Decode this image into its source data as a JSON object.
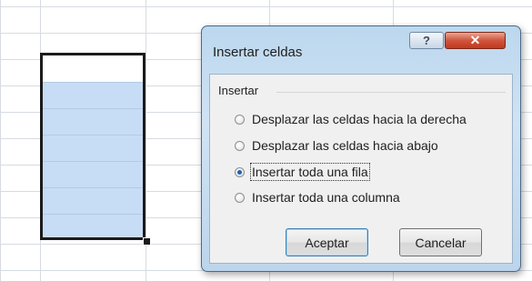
{
  "dialog": {
    "title": "Insertar celdas",
    "help_label": "?",
    "close_label": "✕",
    "group_label": "Insertar",
    "options": [
      {
        "label": "Desplazar las celdas hacia la derecha",
        "selected": false
      },
      {
        "label": "Desplazar las celdas hacia abajo",
        "selected": false
      },
      {
        "label": "Insertar toda una fila",
        "selected": true
      },
      {
        "label": "Insertar toda una columna",
        "selected": false
      }
    ],
    "ok_label": "Aceptar",
    "cancel_label": "Cancelar"
  },
  "colors": {
    "selection_fill": "#c7dcf5",
    "radio_dot": "#1f5fbf",
    "close_button": "#c0391f"
  }
}
